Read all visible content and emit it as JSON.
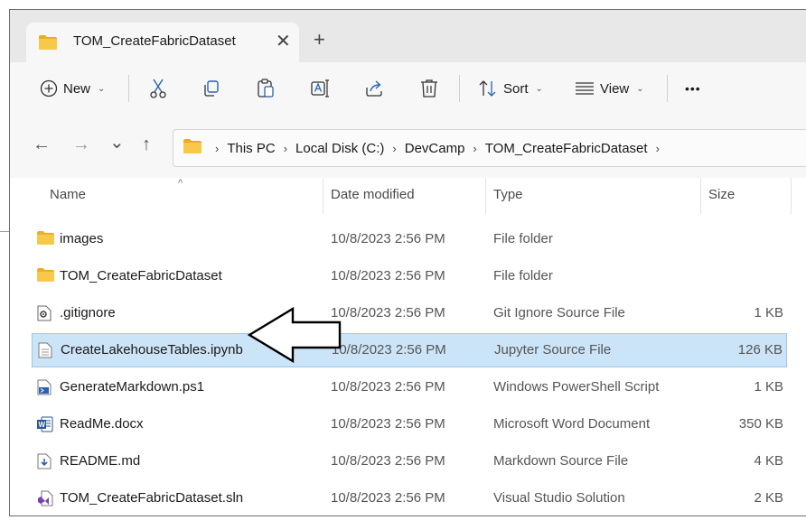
{
  "tab": {
    "title": "TOM_CreateFabricDataset",
    "close": "✕",
    "new": "+"
  },
  "toolbar": {
    "new_label": "New",
    "sort_label": "Sort",
    "view_label": "View",
    "more": "•••"
  },
  "nav": {
    "back": "←",
    "forward": "→",
    "recent": "⌄",
    "up": "↑"
  },
  "breadcrumb": [
    "This PC",
    "Local Disk (C:)",
    "DevCamp",
    "TOM_CreateFabricDataset"
  ],
  "columns": {
    "name": "Name",
    "date": "Date modified",
    "type": "Type",
    "size": "Size"
  },
  "files": [
    {
      "name": "images",
      "date": "10/8/2023 2:56 PM",
      "type": "File folder",
      "size": "",
      "icon": "folder-icon"
    },
    {
      "name": "TOM_CreateFabricDataset",
      "date": "10/8/2023 2:56 PM",
      "type": "File folder",
      "size": "",
      "icon": "folder-icon"
    },
    {
      "name": ".gitignore",
      "date": "10/8/2023 2:56 PM",
      "type": "Git Ignore Source File",
      "size": "1 KB",
      "icon": "config-file-icon"
    },
    {
      "name": "CreateLakehouseTables.ipynb",
      "date": "10/8/2023 2:56 PM",
      "type": "Jupyter Source File",
      "size": "126 KB",
      "icon": "text-file-icon",
      "selected": true
    },
    {
      "name": "GenerateMarkdown.ps1",
      "date": "10/8/2023 2:56 PM",
      "type": "Windows PowerShell Script",
      "size": "1 KB",
      "icon": "powershell-file-icon"
    },
    {
      "name": "ReadMe.docx",
      "date": "10/8/2023 2:56 PM",
      "type": "Microsoft Word Document",
      "size": "350 KB",
      "icon": "word-file-icon"
    },
    {
      "name": "README.md",
      "date": "10/8/2023 2:56 PM",
      "type": "Markdown Source File",
      "size": "4 KB",
      "icon": "markdown-file-icon"
    },
    {
      "name": "TOM_CreateFabricDataset.sln",
      "date": "10/8/2023 2:56 PM",
      "type": "Visual Studio Solution",
      "size": "2 KB",
      "icon": "visual-studio-file-icon"
    }
  ],
  "colors": {
    "selection": "#cce4f7",
    "folder": "#f4c13d",
    "accent": "#1a73c8"
  }
}
